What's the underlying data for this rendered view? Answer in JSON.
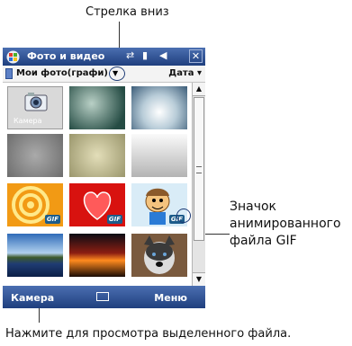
{
  "callouts": {
    "arrow_down": "Стрелка вниз",
    "gif_icon": "Значок\nанимированного\nфайла GIF",
    "view_hint": "Нажмите для просмотра выделенного файла."
  },
  "titlebar": {
    "title": "Фото и видео"
  },
  "toolbar": {
    "folder": "Мои фото(графи)",
    "sort": "Дата",
    "dropdown_arrow": "▼"
  },
  "grid": {
    "camera_label": "Камера",
    "gif_badge": "GIF",
    "thumbs": [
      "camera",
      "frosted-green",
      "blue-haze",
      "gray-texture",
      "beige-texture",
      "gray-gradient",
      "orange-rings",
      "red-hearts",
      "cartoon-boy",
      "lake-sunset",
      "red-sky",
      "husky-dog"
    ]
  },
  "softkeys": {
    "left": "Камера",
    "right": "Меню"
  },
  "colors": {
    "titlebar": "#1f3f7e",
    "accent": "#4b6fb1"
  }
}
